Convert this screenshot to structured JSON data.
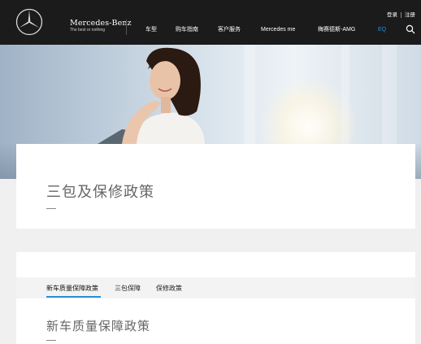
{
  "header": {
    "brand_name": "Mercedes-Benz",
    "brand_tagline": "The best or nothing",
    "utility": {
      "login": "登录",
      "register": "注册"
    },
    "nav": [
      {
        "label": "车型"
      },
      {
        "label": "购车指南"
      },
      {
        "label": "客户服务"
      },
      {
        "label": "Mercedes me"
      },
      {
        "label": "梅赛德斯-AMG"
      },
      {
        "label": "EQ"
      }
    ],
    "active_nav": "EQ",
    "icons": {
      "logo": "mercedes-star-icon",
      "search": "search-icon"
    }
  },
  "hero": {
    "image": "woman-smiling-in-car-photo"
  },
  "page": {
    "title": "三包及保修政策"
  },
  "tabs": {
    "items": [
      {
        "label": "新车质量保障政策"
      },
      {
        "label": "三包保障"
      },
      {
        "label": "保修政策"
      }
    ],
    "active": "新车质量保障政策"
  },
  "section": {
    "title": "新车质量保障政策"
  },
  "colors": {
    "header_bg": "#1b1b1b",
    "accent": "#2b8fd6",
    "page_bg": "#f0f0f0"
  }
}
